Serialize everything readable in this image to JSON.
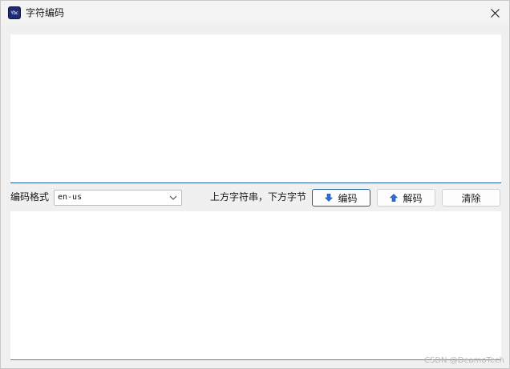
{
  "window": {
    "title": "字符编码",
    "app_icon_text": "Ybc"
  },
  "controls": {
    "format_label": "编码格式",
    "format_value": "en-us",
    "hint": "上方字符串，下方字节",
    "encode_label": "编码",
    "decode_label": "解码",
    "clear_label": "清除"
  },
  "inputs": {
    "top_text": "",
    "bottom_text": ""
  },
  "watermark": "CSDN @DeamoTech",
  "colors": {
    "accent": "#1f5c9c",
    "arrow": "#2b6fd6"
  }
}
